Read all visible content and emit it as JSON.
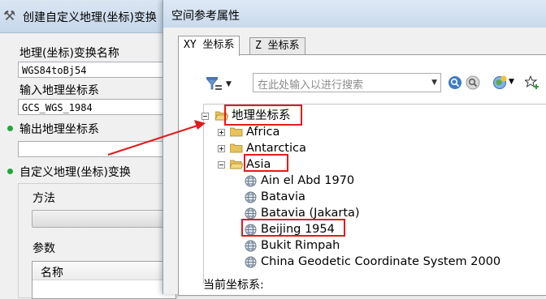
{
  "background_dialog": {
    "title": "创建自定义地理(坐标)变换",
    "transform_name_label": "地理(坐标)变换名称",
    "transform_name_value": "WGS84toBj54",
    "input_gcs_label": "输入地理坐标系",
    "input_gcs_value": "GCS_WGS_1984",
    "output_gcs_label": "输出地理坐标系",
    "output_gcs_value": "",
    "custom_transform_label": "自定义地理(坐标)变换",
    "method_label": "方法",
    "params_label": "参数",
    "grid_header_name": "名称"
  },
  "dialog": {
    "title": "空间参考属性",
    "tabs": [
      {
        "label": "XY 坐标系"
      },
      {
        "label": "Z 坐标系"
      }
    ],
    "search_placeholder": "在此处输入以进行搜索",
    "current_cs_label": "当前坐标系:"
  },
  "tree": {
    "root": {
      "label": "地理坐标系",
      "expanded": true
    },
    "items": [
      {
        "label": "Africa",
        "type": "folder",
        "expanded": false
      },
      {
        "label": "Antarctica",
        "type": "folder",
        "expanded": false
      },
      {
        "label": "Asia",
        "type": "folder",
        "expanded": true
      },
      {
        "label": "Ain el Abd 1970",
        "type": "cs"
      },
      {
        "label": "Batavia",
        "type": "cs"
      },
      {
        "label": "Batavia (Jakarta)",
        "type": "cs"
      },
      {
        "label": "Beijing 1954",
        "type": "cs"
      },
      {
        "label": "Bukit Rimpah",
        "type": "cs"
      },
      {
        "label": "China Geodetic Coordinate System 2000",
        "type": "cs"
      }
    ]
  },
  "colors": {
    "highlight": "#e21b1b",
    "status_dot": "#22a63a",
    "folder": "#e8c35a"
  }
}
